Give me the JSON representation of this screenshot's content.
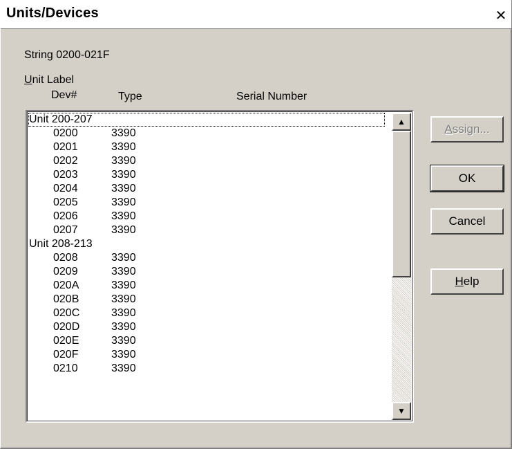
{
  "window": {
    "title": "Units/Devices",
    "close_glyph": "✕"
  },
  "string_label": "String 0200-021F",
  "headers": {
    "unit_label_first": "U",
    "unit_label_rest": "nit Label",
    "dev": "Dev#",
    "type": "Type",
    "serial": "Serial Number"
  },
  "list": [
    {
      "group": "Unit 200-207"
    },
    {
      "dev": "0200",
      "type": "3390",
      "serial": ""
    },
    {
      "dev": "0201",
      "type": "3390",
      "serial": ""
    },
    {
      "dev": "0202",
      "type": "3390",
      "serial": ""
    },
    {
      "dev": "0203",
      "type": "3390",
      "serial": ""
    },
    {
      "dev": "0204",
      "type": "3390",
      "serial": ""
    },
    {
      "dev": "0205",
      "type": "3390",
      "serial": ""
    },
    {
      "dev": "0206",
      "type": "3390",
      "serial": ""
    },
    {
      "dev": "0207",
      "type": "3390",
      "serial": ""
    },
    {
      "group": "Unit 208-213"
    },
    {
      "dev": "0208",
      "type": "3390",
      "serial": ""
    },
    {
      "dev": "0209",
      "type": "3390",
      "serial": ""
    },
    {
      "dev": "020A",
      "type": "3390",
      "serial": ""
    },
    {
      "dev": "020B",
      "type": "3390",
      "serial": ""
    },
    {
      "dev": "020C",
      "type": "3390",
      "serial": ""
    },
    {
      "dev": "020D",
      "type": "3390",
      "serial": ""
    },
    {
      "dev": "020E",
      "type": "3390",
      "serial": ""
    },
    {
      "dev": "020F",
      "type": "3390",
      "serial": ""
    },
    {
      "dev": "0210",
      "type": "3390",
      "serial": ""
    }
  ],
  "scrollbar": {
    "up_glyph": "▲",
    "down_glyph": "▼"
  },
  "buttons": {
    "assign": {
      "mnemonic": "A",
      "rest": "ssign...",
      "enabled": false
    },
    "ok": "OK",
    "cancel": "Cancel",
    "help": {
      "mnemonic": "H",
      "rest": "elp"
    }
  }
}
